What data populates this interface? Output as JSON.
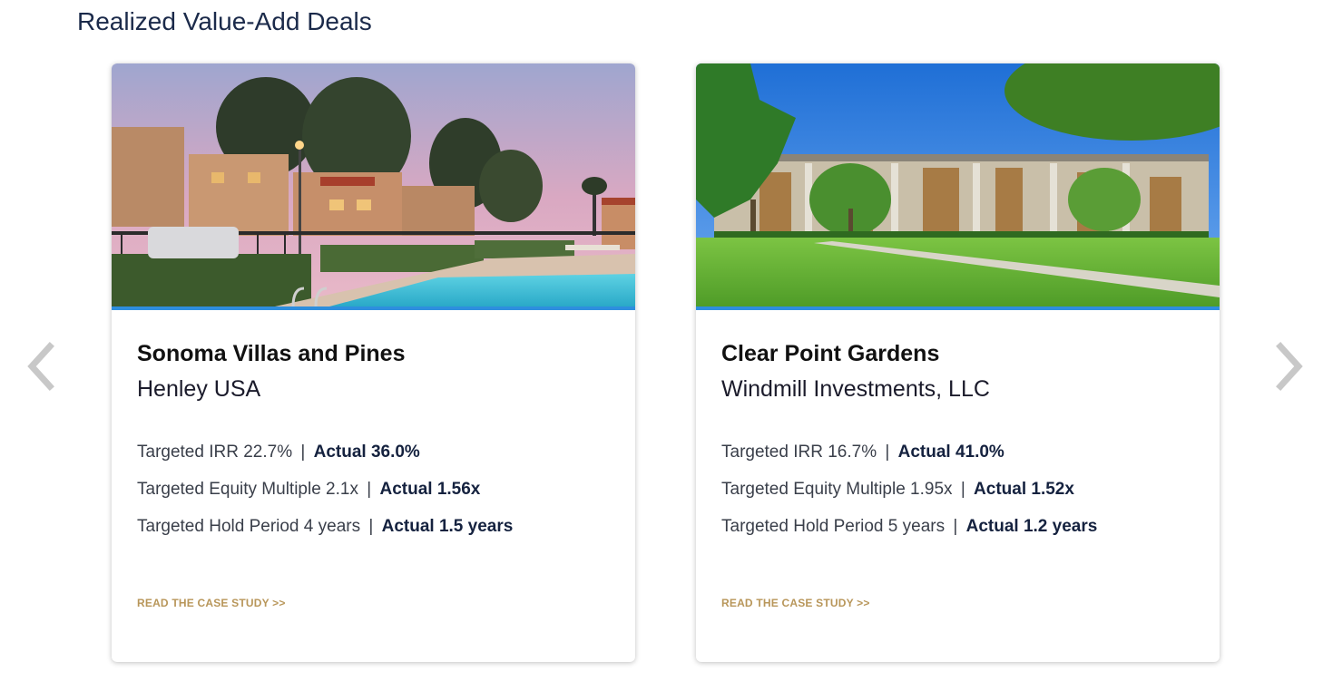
{
  "section": {
    "title": "Realized Value-Add Deals"
  },
  "carousel": {
    "prev_icon": "chevron-left-icon",
    "next_icon": "chevron-right-icon",
    "arrow_color": "#c8c8c8"
  },
  "colors": {
    "accent_blue": "#2e8ede",
    "link_gold": "#b8965a",
    "navy_text": "#15223f"
  },
  "cards": [
    {
      "title": "Sonoma Villas and Pines",
      "sponsor": "Henley USA",
      "metrics": [
        {
          "target": "Targeted IRR 22.7%",
          "actual": "Actual 36.0%"
        },
        {
          "target": "Targeted Equity Multiple 2.1x",
          "actual": "Actual 1.56x"
        },
        {
          "target": "Targeted Hold Period 4 years",
          "actual": "Actual 1.5 years"
        }
      ],
      "separator": "|",
      "link": "READ THE CASE STUDY >>"
    },
    {
      "title": "Clear Point Gardens",
      "sponsor": "Windmill Investments, LLC",
      "metrics": [
        {
          "target": "Targeted IRR 16.7%",
          "actual": "Actual 41.0%"
        },
        {
          "target": "Targeted Equity Multiple 1.95x",
          "actual": "Actual 1.52x"
        },
        {
          "target": "Targeted Hold Period 5 years",
          "actual": "Actual 1.2 years"
        }
      ],
      "separator": "|",
      "link": "READ THE CASE STUDY >>"
    }
  ]
}
